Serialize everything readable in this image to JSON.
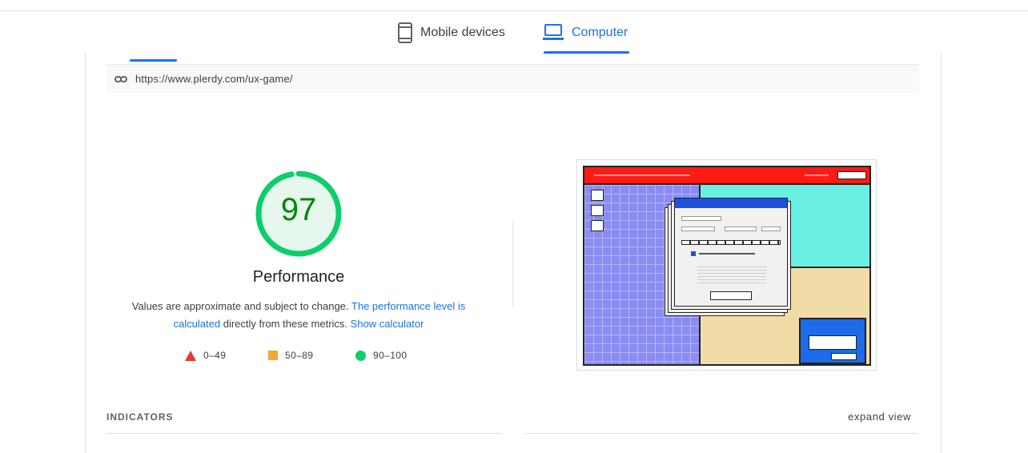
{
  "tabs": [
    {
      "label": "Mobile devices",
      "icon": "phone-icon",
      "active": false
    },
    {
      "label": "Computer",
      "icon": "laptop-icon",
      "active": true
    }
  ],
  "url": "https://www.plerdy.com/ux-game/",
  "score": {
    "value": "97",
    "fraction": 0.97,
    "color": "#0cce6b",
    "text_color": "#008800",
    "label": "Performance"
  },
  "description": {
    "part1": "Values are approximate and subject to change.",
    "link1": "The performance level is calculated",
    "part2": "directly from these metrics.",
    "link2": "Show calculator"
  },
  "legend": [
    {
      "range": "0–49",
      "shape": "triangle",
      "color": "#e53935"
    },
    {
      "range": "50–89",
      "shape": "square",
      "color": "#f4a732"
    },
    {
      "range": "90–100",
      "shape": "circle",
      "color": "#0cce6b"
    }
  ],
  "section": {
    "title": "INDICATORS",
    "expand": "expand view"
  },
  "colors": {
    "accent": "#1a73e8"
  }
}
